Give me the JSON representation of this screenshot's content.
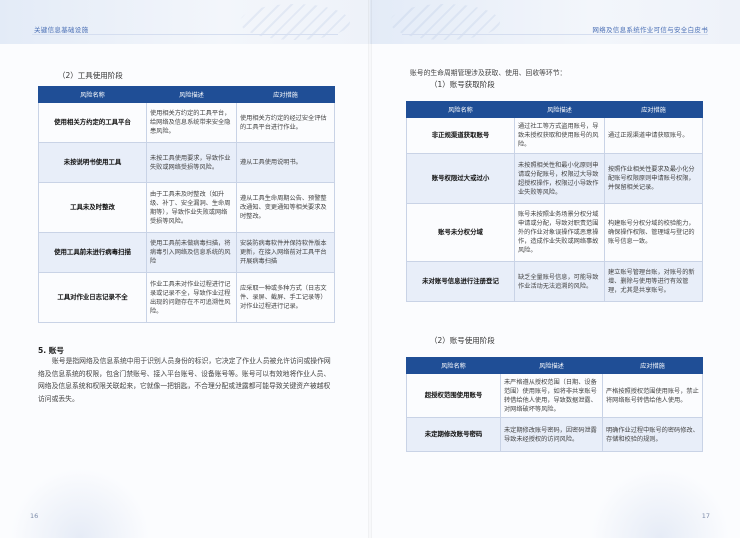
{
  "left_page": {
    "header": "关键信息基础设施",
    "section_title": "（2）工具使用阶段",
    "table": {
      "headers": [
        "风险名称",
        "风险描述",
        "应对措施"
      ],
      "rows": [
        {
          "name": "使用相关方约定的工具平台",
          "desc": "使用相关方约定的工具平台，给网络及信息系统带来安全隐患风险。",
          "measure": "使用相关方约定的经过安全评估的工具平台进行作业。"
        },
        {
          "name": "未按说明书使用工具",
          "desc": "未按工具使用要求，导致作业失败或网络受损等风险。",
          "measure": "遵从工具使用说明书。"
        },
        {
          "name": "工具未及时整改",
          "desc": "由于工具未及时整改（如升级、补丁、安全漏洞、生命周期等），导致作业失败或网络受损等风险。",
          "measure": "遵从工具生命周期公告、预警整改通知、变更通知等相关要求及时整改。"
        },
        {
          "name": "使用工具前未进行病毒扫描",
          "desc": "使用工具前未做病毒扫描，将病毒引入网络及信息系统的风险",
          "measure": "安装防病毒软件并保持软件版本更新，在接入网络前对工具平台开展病毒扫描"
        },
        {
          "name": "工具对作业日志记录不全",
          "desc": "作业工具未对作业过程进行记录或记录不全，导致作业过程出现的问题存在不可追溯性风险。",
          "measure": "应采取一种或多种方式（日志文件、录屏、截屏、手工记录等）对作业过程进行记录。"
        }
      ]
    },
    "heading": "5. 账号",
    "paragraph": "账号是指网络及信息系统中用于识别人员身份的标识，它决定了作业人员被允许访问或操作网络及信息系统的权限，包含门禁账号、接入平台账号、设备账号等。账号可以有效地将作业人员、网络及信息系统和权限关联起来，它就像一把钥匙，不合理分配或泄露都可能导致关键资产被越权访问或丢失。",
    "page_number": "16"
  },
  "right_page": {
    "header": "网络及信息系统作业可信与安全白皮书",
    "intro": "账号的生命周期管理涉及获取、使用、回收等环节：",
    "section1_title": "（1）账号获取阶段",
    "table1": {
      "headers": [
        "风险名称",
        "风险描述",
        "应对措施"
      ],
      "rows": [
        {
          "name": "非正规渠道获取账号",
          "desc": "通过社工等方式盗用账号，导致未授权获取和使用账号的风险。",
          "measure": "通过正规渠道申请获取账号。"
        },
        {
          "name": "账号权限过大或过小",
          "desc": "未按照相关性和最小化原则申请或分配账号，权限过大导致超授权操作，权限过小导致作业失败等风险。",
          "measure": "按照作业相关性要求及最小化分配账号权限原则申请账号权限，并保留相关记录。"
        },
        {
          "name": "账号未分权分域",
          "desc": "账号未按照业务场景分权分域申请或分配，导致对职责范围外的作业对象误操作或恶意操作，造成作业失败或网络事故风险。",
          "measure": "构建账号分权分域的校验能力，确保操作权限、管理域与登记的账号信息一致。"
        },
        {
          "name": "未对账号信息进行注册登记",
          "desc": "缺乏全量账号信息，可能导致作业活动无法追溯的风险。",
          "measure": "建立账号管理台账，对账号的新增、删除与使用等进行有效管理，尤其是共享账号。"
        }
      ]
    },
    "section2_title": "（2）账号使用阶段",
    "table2": {
      "headers": [
        "风险名称",
        "风险描述",
        "应对措施"
      ],
      "rows": [
        {
          "name": "超授权范围使用账号",
          "desc": "未严格遵从授权范围（日期、设备范围）使用账号，如将非共享账号转借给他人使用，导致数据泄露、对网络破坏等风险。",
          "measure": "严格按照授权范围使用账号，禁止将网络账号转借给他人使用。"
        },
        {
          "name": "未定期修改账号密码",
          "desc": "未定期修改账号密码，因密码泄露导致未经授权的访问风险。",
          "measure": "明确作业过程中账号的密码修改、存储和校验的规则。"
        }
      ]
    },
    "page_number": "17"
  }
}
